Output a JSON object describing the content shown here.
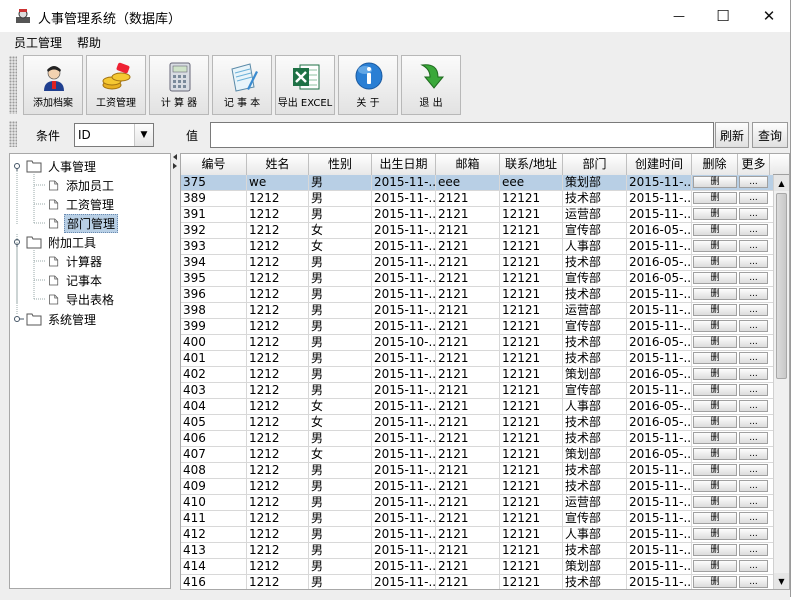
{
  "window": {
    "title": "人事管理系统（数据库）",
    "minimize_glyph": "—",
    "maximize_glyph": "☐",
    "close_glyph": "✕"
  },
  "menu": [
    "员工管理",
    "帮助"
  ],
  "toolbar": [
    {
      "label": "添加档案",
      "icon": "user-add-icon"
    },
    {
      "label": "工资管理",
      "icon": "salary-coins-icon"
    },
    {
      "label": "计 算 器",
      "icon": "calculator-icon"
    },
    {
      "label": "记 事 本",
      "icon": "notepad-icon"
    },
    {
      "label": "导出 EXCEL",
      "icon": "excel-icon"
    },
    {
      "label": "关 于",
      "icon": "info-icon"
    },
    {
      "label": "退 出",
      "icon": "exit-arrow-icon"
    }
  ],
  "search": {
    "condition_label": "条件",
    "field_value": "ID",
    "value_label": "值",
    "refresh_label": "刷新",
    "query_label": "查询"
  },
  "tree": [
    {
      "label": "人事管理",
      "level": 0,
      "expanded": true,
      "type": "folder"
    },
    {
      "label": "添加员工",
      "level": 1,
      "type": "leaf"
    },
    {
      "label": "工资管理",
      "level": 1,
      "type": "leaf"
    },
    {
      "label": "部门管理",
      "level": 1,
      "type": "leaf",
      "selected": true
    },
    {
      "label": "附加工具",
      "level": 0,
      "expanded": true,
      "type": "folder"
    },
    {
      "label": "计算器",
      "level": 1,
      "type": "leaf"
    },
    {
      "label": "记事本",
      "level": 1,
      "type": "leaf"
    },
    {
      "label": "导出表格",
      "level": 1,
      "type": "leaf"
    },
    {
      "label": "系统管理",
      "level": 0,
      "expanded": false,
      "type": "folder"
    }
  ],
  "table": {
    "headers": [
      "编号",
      "姓名",
      "性别",
      "出生日期",
      "邮箱",
      "联系/地址",
      "部门",
      "创建时间",
      "删除",
      "更多"
    ],
    "delete_label": "删",
    "more_label": "...",
    "rows": [
      [
        "375",
        "we",
        "男",
        "2015-11-...",
        "eee",
        "eee",
        "策划部",
        "2015-11-..."
      ],
      [
        "389",
        "1212",
        "男",
        "2015-11-...",
        "2121",
        "12121",
        "技术部",
        "2015-11-..."
      ],
      [
        "391",
        "1212",
        "男",
        "2015-11-...",
        "2121",
        "12121",
        "运营部",
        "2015-11-..."
      ],
      [
        "392",
        "1212",
        "女",
        "2015-11-...",
        "2121",
        "12121",
        "宣传部",
        "2016-05-..."
      ],
      [
        "393",
        "1212",
        "女",
        "2015-11-...",
        "2121",
        "12121",
        "人事部",
        "2015-11-..."
      ],
      [
        "394",
        "1212",
        "男",
        "2015-11-...",
        "2121",
        "12121",
        "技术部",
        "2016-05-..."
      ],
      [
        "395",
        "1212",
        "男",
        "2015-11-...",
        "2121",
        "12121",
        "宣传部",
        "2016-05-..."
      ],
      [
        "396",
        "1212",
        "男",
        "2015-11-...",
        "2121",
        "12121",
        "技术部",
        "2015-11-..."
      ],
      [
        "398",
        "1212",
        "男",
        "2015-11-...",
        "2121",
        "12121",
        "运营部",
        "2015-11-..."
      ],
      [
        "399",
        "1212",
        "男",
        "2015-11-...",
        "2121",
        "12121",
        "宣传部",
        "2015-11-..."
      ],
      [
        "400",
        "1212",
        "男",
        "2015-10-...",
        "2121",
        "12121",
        "技术部",
        "2016-05-..."
      ],
      [
        "401",
        "1212",
        "男",
        "2015-11-...",
        "2121",
        "12121",
        "技术部",
        "2015-11-..."
      ],
      [
        "402",
        "1212",
        "男",
        "2015-11-...",
        "2121",
        "12121",
        "策划部",
        "2016-05-..."
      ],
      [
        "403",
        "1212",
        "男",
        "2015-11-...",
        "2121",
        "12121",
        "宣传部",
        "2015-11-..."
      ],
      [
        "404",
        "1212",
        "女",
        "2015-11-...",
        "2121",
        "12121",
        "人事部",
        "2016-05-..."
      ],
      [
        "405",
        "1212",
        "女",
        "2015-11-...",
        "2121",
        "12121",
        "技术部",
        "2016-05-..."
      ],
      [
        "406",
        "1212",
        "男",
        "2015-11-...",
        "2121",
        "12121",
        "技术部",
        "2015-11-..."
      ],
      [
        "407",
        "1212",
        "女",
        "2015-11-...",
        "2121",
        "12121",
        "策划部",
        "2016-05-..."
      ],
      [
        "408",
        "1212",
        "男",
        "2015-11-...",
        "2121",
        "12121",
        "技术部",
        "2015-11-..."
      ],
      [
        "409",
        "1212",
        "男",
        "2015-11-...",
        "2121",
        "12121",
        "技术部",
        "2015-11-..."
      ],
      [
        "410",
        "1212",
        "男",
        "2015-11-...",
        "2121",
        "12121",
        "运营部",
        "2015-11-..."
      ],
      [
        "411",
        "1212",
        "男",
        "2015-11-...",
        "2121",
        "12121",
        "宣传部",
        "2015-11-..."
      ],
      [
        "412",
        "1212",
        "男",
        "2015-11-...",
        "2121",
        "12121",
        "人事部",
        "2015-11-..."
      ],
      [
        "413",
        "1212",
        "男",
        "2015-11-...",
        "2121",
        "12121",
        "技术部",
        "2015-11-..."
      ],
      [
        "414",
        "1212",
        "男",
        "2015-11-...",
        "2121",
        "12121",
        "策划部",
        "2015-11-..."
      ],
      [
        "416",
        "1212",
        "男",
        "2015-11-...",
        "2121",
        "12121",
        "技术部",
        "2015-11-..."
      ]
    ]
  },
  "colors": {
    "selection": "#b8cfe5",
    "window_bg": "#eeeeee",
    "excel_green": "#1e7145",
    "info_blue": "#2a7fd4"
  }
}
